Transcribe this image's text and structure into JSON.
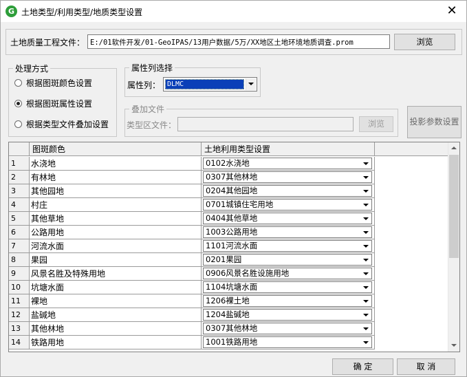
{
  "window": {
    "title": "土地类型/利用类型/地质类型设置",
    "app_icon_letter": "G",
    "close_glyph": "✕"
  },
  "project_file": {
    "label": "土地质量工程文件：",
    "value": "E:/01软件开发/01-GeoIPAS/13用户数据/5万/XX地区土地环境地质调查.prom",
    "browse_label": "浏览"
  },
  "processing": {
    "title": "处理方式",
    "options": [
      {
        "label": "根据图斑颜色设置",
        "selected": false
      },
      {
        "label": "根据图斑属性设置",
        "selected": true
      },
      {
        "label": "根据类型文件叠加设置",
        "selected": false
      }
    ]
  },
  "attribute": {
    "title": "属性列选择",
    "label": "属性列：",
    "value": "DLMC"
  },
  "overlay": {
    "title": "叠加文件",
    "label": "类型区文件：",
    "value": "",
    "browse_label": "浏览"
  },
  "projection_button": "投影参数设置",
  "table": {
    "headers": [
      "",
      "图斑颜色",
      "土地利用类型设置"
    ],
    "rows": [
      {
        "num": "1",
        "color": "水浇地",
        "type": "0102水浇地"
      },
      {
        "num": "2",
        "color": "有林地",
        "type": "0307其他林地"
      },
      {
        "num": "3",
        "color": "其他园地",
        "type": "0204其他园地"
      },
      {
        "num": "4",
        "color": "村庄",
        "type": "0701城镇住宅用地"
      },
      {
        "num": "5",
        "color": "其他草地",
        "type": "0404其他草地"
      },
      {
        "num": "6",
        "color": "公路用地",
        "type": "1003公路用地"
      },
      {
        "num": "7",
        "color": "河流水面",
        "type": "1101河流水面"
      },
      {
        "num": "8",
        "color": "果园",
        "type": "0201果园"
      },
      {
        "num": "9",
        "color": "风景名胜及特殊用地",
        "type": "0906风景名胜设施用地"
      },
      {
        "num": "10",
        "color": "坑塘水面",
        "type": "1104坑塘水面"
      },
      {
        "num": "11",
        "color": "裸地",
        "type": "1206裸土地"
      },
      {
        "num": "12",
        "color": "盐碱地",
        "type": "1204盐碱地"
      },
      {
        "num": "13",
        "color": "其他林地",
        "type": "0307其他林地"
      },
      {
        "num": "14",
        "color": "铁路用地",
        "type": "1001铁路用地"
      }
    ]
  },
  "footer": {
    "ok_label": "确  定",
    "cancel_label": "取  消"
  }
}
